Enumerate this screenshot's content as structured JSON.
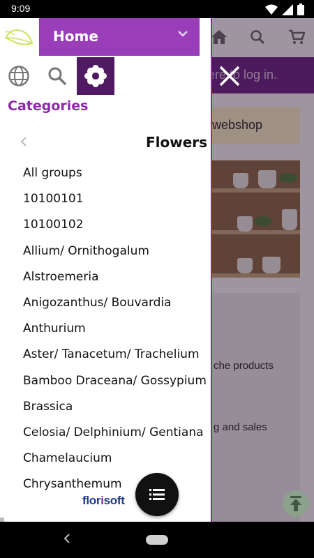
{
  "status_bar": {
    "time": "9:09",
    "icons": [
      "wifi-icon",
      "signal-icon",
      "battery-icon"
    ]
  },
  "drawer": {
    "home_select": {
      "label": "Home"
    },
    "tabs": [
      {
        "icon": "globe-icon",
        "active": false
      },
      {
        "icon": "search-icon",
        "active": false
      },
      {
        "icon": "flower-icon",
        "active": true
      }
    ],
    "categories_title": "Categories",
    "current_group": "Flowers",
    "items": [
      "All groups",
      "10100101",
      "10100102",
      "Allium/ Ornithogalum",
      "Alstroemeria",
      "Anigozanthus/ Bouvardia",
      "Anthurium",
      "Aster/ Tanacetum/ Trachelium",
      "Bamboo Draceana/ Gossypium",
      "Brassica",
      "Celosia/ Delphinium/ Gentiana",
      "Chamelaucium",
      "Chrysanthemum"
    ],
    "brand": {
      "part1": "flor",
      "part2": "i",
      "part3": "soft"
    }
  },
  "background_page": {
    "login_text": "ere to log in.",
    "banner_text": "webshop",
    "text_1": "che products",
    "text_2": "g and sales"
  },
  "colors": {
    "accent": "#9a3db8",
    "accent_dark": "#4f1a62",
    "category_title": "#8c2aa8",
    "login_bar": "#6b1f86"
  }
}
